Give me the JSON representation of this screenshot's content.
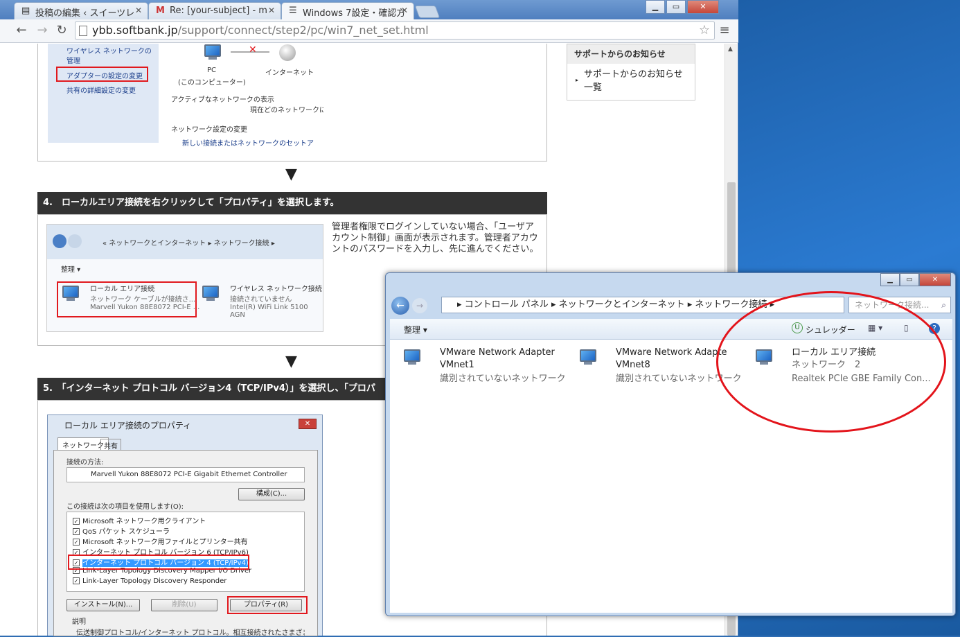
{
  "browser": {
    "tabs": [
      {
        "label": "投稿の編集 ‹ スイーツレ",
        "icon": "page-icon"
      },
      {
        "label": "Re: [your-subject] - m",
        "icon": "gmail-icon"
      },
      {
        "label": "Windows 7設定・確認方",
        "icon": "page-icon"
      }
    ],
    "url_host": "ybb.softbank.jp",
    "url_path": "/support/connect/step2/pc/win7_net_set.html"
  },
  "page": {
    "top_shot": {
      "side_items": [
        "ワイヤレス ネットワークの管理",
        "アダプターの設定の変更",
        "共有の詳細設定の変更"
      ],
      "pc_label": "PC",
      "pc_sub": "(このコンピューター)",
      "internet_label": "インターネット",
      "active_label": "アクティブなネットワークの表示",
      "current_label": "現在どのネットワークにも",
      "settings_label": "ネットワーク設定の変更",
      "new_conn": "新しい接続またはネットワークのセットア"
    },
    "step4": {
      "heading": "4.　ローカルエリア接続を右クリックして「プロパティ」を選択します。",
      "note": "管理者権限でログインしていない場合、「ユーザアカウント制御」画面が表示されます。管理者アカウントのパスワードを入力し、先に進んでください。",
      "breadcrumb": "« ネットワークとインターネット ▸ ネットワーク接続 ▸",
      "organize": "整理 ▾",
      "adapters": [
        {
          "name": "ローカル エリア接続",
          "status": "ネットワーク ケーブルが接続さ...",
          "device": "Marvell Yukon 88E8072 PCI-E ..."
        },
        {
          "name": "ワイヤレス ネットワーク接続",
          "status": "接続されていません",
          "device": "Intel(R) WiFi Link 5100 AGN"
        }
      ]
    },
    "step5": {
      "heading": "5.　「インターネット プロトコル バージョン4（TCP/IPv4）」を選択し、「プロパ",
      "dialog_title": "ローカル エリア接続のプロパティ",
      "tabs": [
        "ネットワーク",
        "共有"
      ],
      "connect_using": "接続の方法:",
      "controller": "Marvell Yukon 88E8072 PCI-E Gigabit Ethernet Controller",
      "configure": "構成(C)...",
      "items_label": "この接続は次の項目を使用します(O):",
      "items": [
        "Microsoft ネットワーク用クライアント",
        "QoS パケット スケジューラ",
        "Microsoft ネットワーク用ファイルとプリンター共有",
        "インターネット プロトコル バージョン 6 (TCP/IPv6)",
        "インターネット プロトコル バージョン 4 (TCP/IPv4)",
        "Link-Layer Topology Discovery Mapper I/O Driver",
        "Link-Layer Topology Discovery Responder"
      ],
      "install": "インストール(N)...",
      "uninstall": "削除(U)",
      "properties": "プロパティ(R)",
      "desc_label": "説明",
      "desc": "伝送制御プロトコル/インターネット プロトコル。相互接続されたさまざまな"
    },
    "notice": {
      "heading": "サポートからのお知らせ",
      "link": "サポートからのお知らせ一覧"
    }
  },
  "explorer": {
    "breadcrumb": [
      "コントロール パネル",
      "ネットワークとインターネット",
      "ネットワーク接続"
    ],
    "search_placeholder": "ネットワーク接続...",
    "organize": "整理 ▾",
    "shredder": "シュレッダー",
    "adapters": [
      {
        "name": "VMware Network Adapter",
        "sub": "VMnet1",
        "status": "識別されていないネットワーク"
      },
      {
        "name": "VMware Network Adapte",
        "sub": "VMnet8",
        "status": "識別されていないネットワーク"
      },
      {
        "name": "ローカル エリア接続",
        "sub": "ネットワーク　2",
        "status": "Realtek PCIe GBE Family Con..."
      }
    ]
  },
  "colors": {
    "highlight": "#e1191e",
    "step_header": "#333333",
    "selected_item": "#3399ff"
  }
}
